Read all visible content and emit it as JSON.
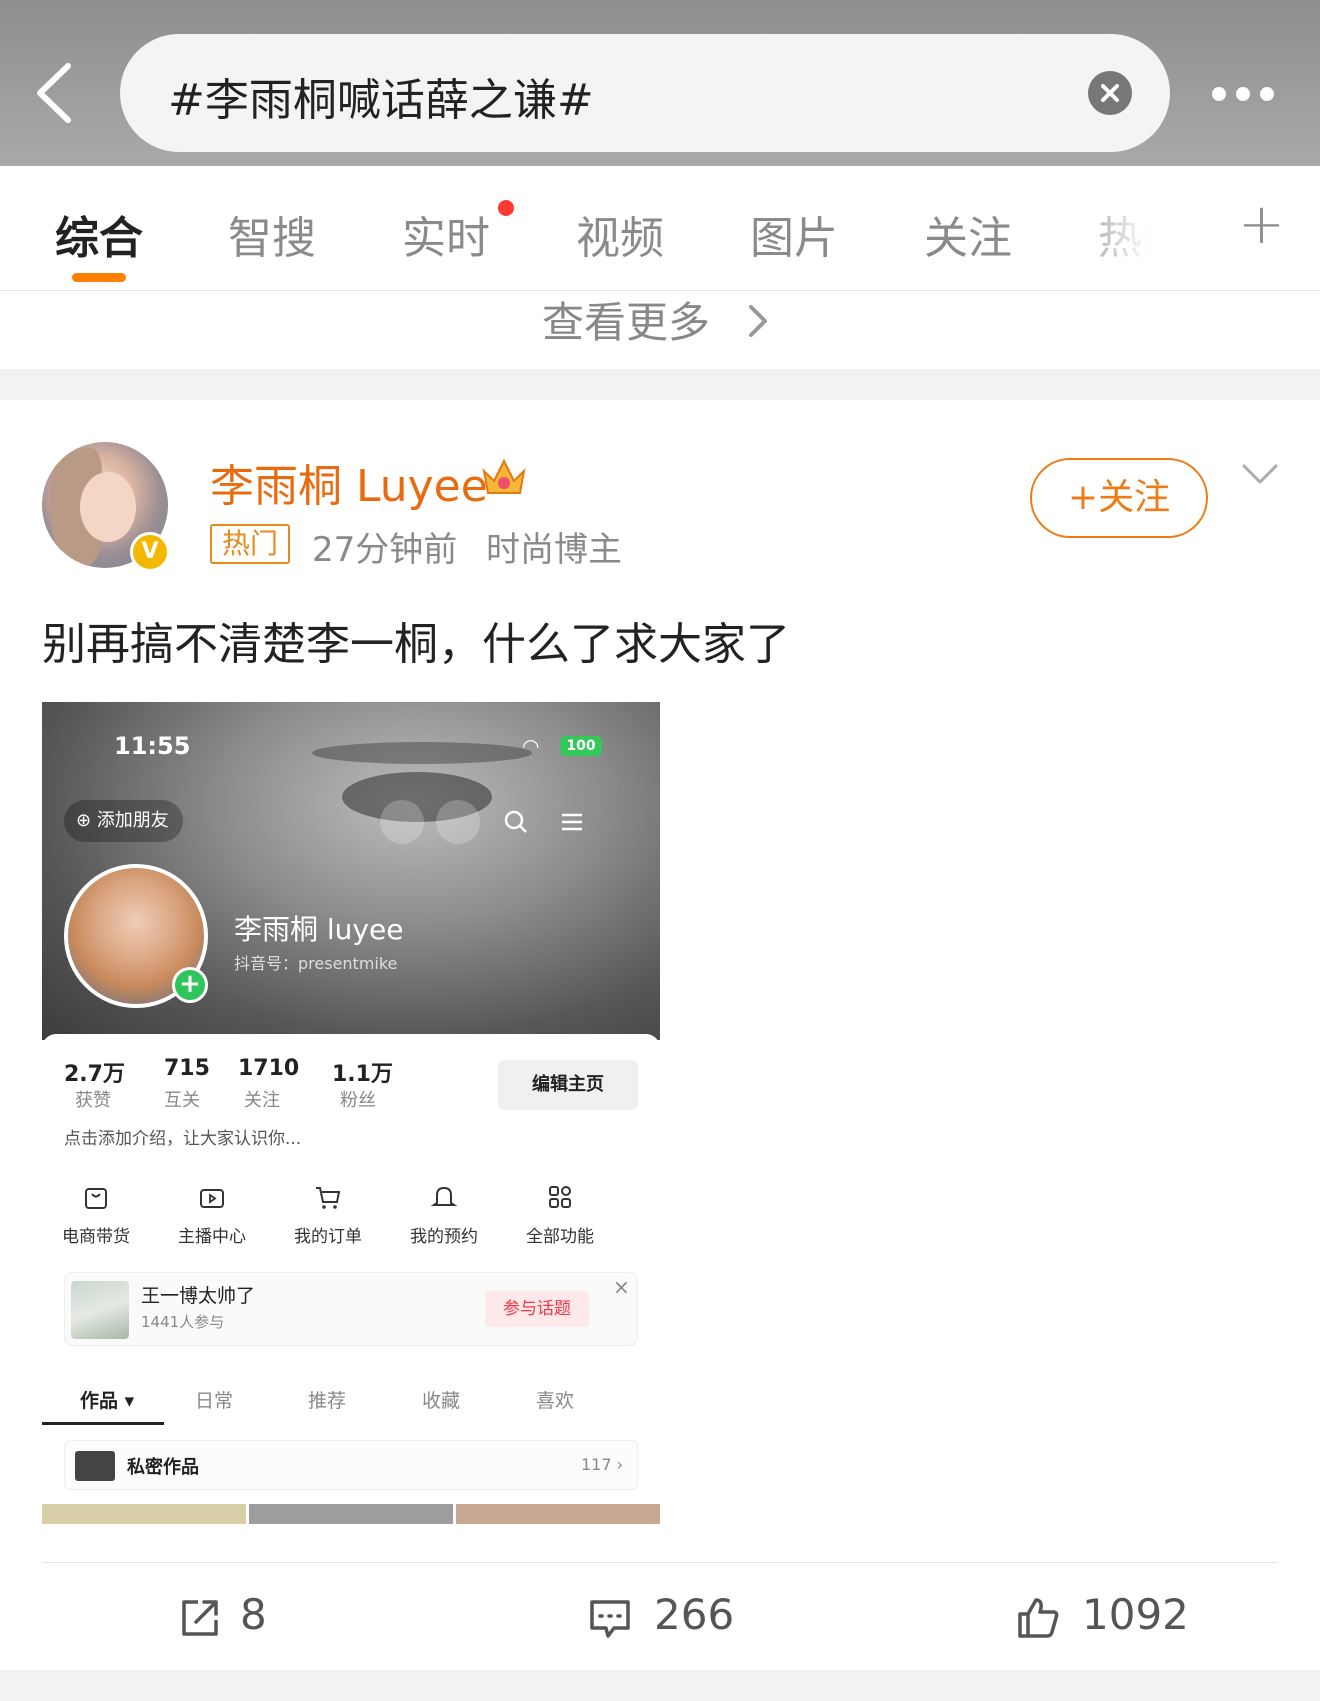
{
  "header": {
    "search_query": "#李雨桐喊话薛之谦#",
    "back_icon": "chevron-left-icon",
    "clear_icon": "close-circle-icon",
    "more_icon": "more-horizontal-icon"
  },
  "tabs": [
    {
      "label": "综合",
      "active": true
    },
    {
      "label": "智搜"
    },
    {
      "label": "实时",
      "has_dot": true
    },
    {
      "label": "视频"
    },
    {
      "label": "图片"
    },
    {
      "label": "关注"
    },
    {
      "label": "热门"
    }
  ],
  "tabs_add_label": "+",
  "see_more": "查看更多",
  "post": {
    "author": "李雨桐 Luyee",
    "hot_tag": "热门",
    "time": "27分钟前",
    "source": "时尚博主",
    "follow_label": "+关注",
    "text": "别再搞不清楚李一桐，什么了求大家了",
    "image": {
      "status_time": "11:55",
      "battery": "100",
      "add_friend": "添加朋友",
      "profile_name": "李雨桐 luyee",
      "douyin_id": "抖音号：presentmike",
      "stats": [
        {
          "num": "2.7万",
          "label": "获赞"
        },
        {
          "num": "715",
          "label": "互关"
        },
        {
          "num": "1710",
          "label": "关注"
        },
        {
          "num": "1.1万",
          "label": "粉丝"
        }
      ],
      "edit_profile": "编辑主页",
      "bio_placeholder": "点击添加介绍，让大家认识你...",
      "functions": [
        "电商带货",
        "主播中心",
        "我的订单",
        "我的预约",
        "全部功能"
      ],
      "topic": {
        "title": "王一博太帅了",
        "participants": "1441人参与",
        "button": "参与话题",
        "close": "×"
      },
      "content_tabs": [
        "作品 ▾",
        "日常",
        "推荐",
        "收藏",
        "喜欢"
      ],
      "private_works": {
        "label": "私密作品",
        "count": "117 ›"
      }
    },
    "actions": {
      "reposts": "8",
      "comments": "266",
      "likes": "1092"
    }
  }
}
